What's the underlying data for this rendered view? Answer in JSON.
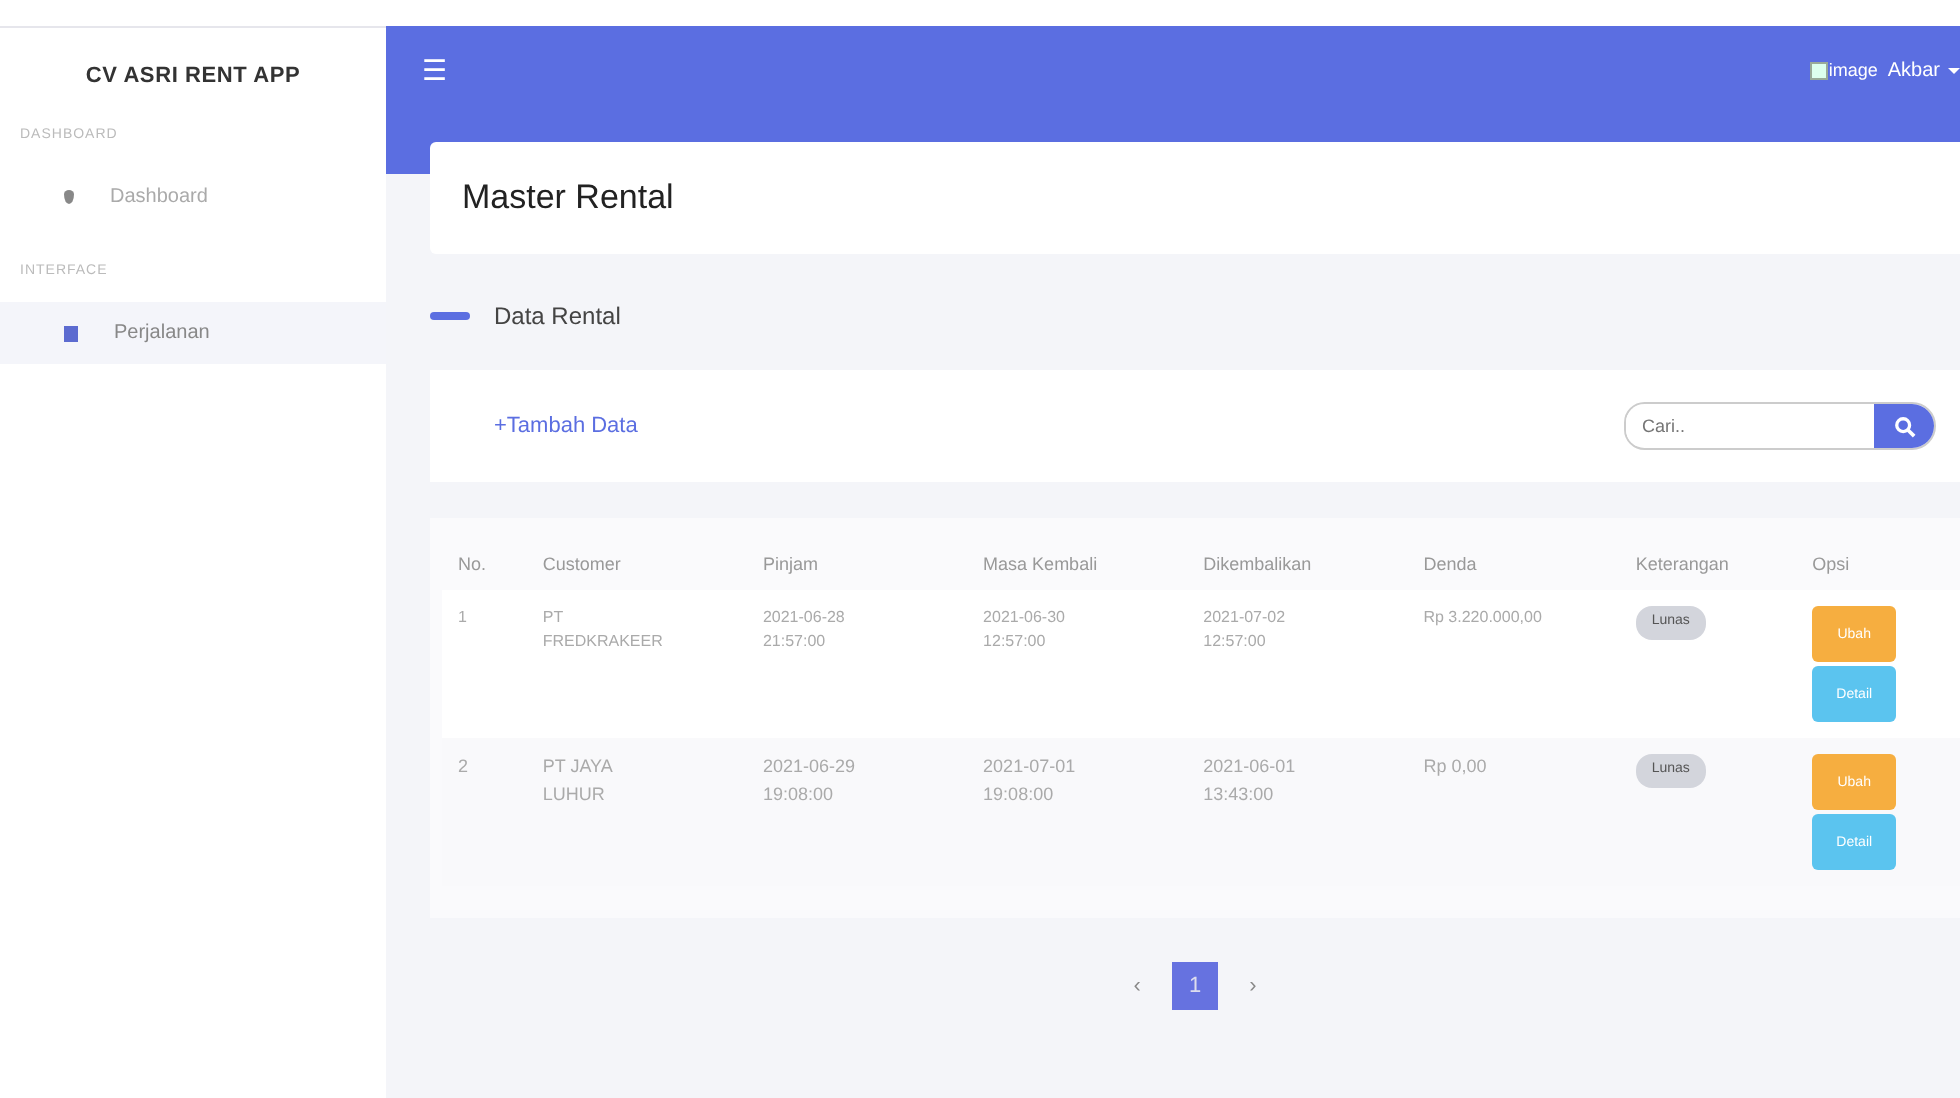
{
  "sidebar": {
    "brand": "CV ASRI RENT APP",
    "sections": [
      {
        "heading": "DASHBOARD",
        "items": [
          {
            "label": "Dashboard",
            "selected": false
          }
        ]
      },
      {
        "heading": "INTERFACE",
        "items": [
          {
            "label": "Perjalanan",
            "selected": true
          }
        ]
      }
    ]
  },
  "topbar": {
    "menu": "☰",
    "image_alt": "image",
    "user": "Akbar"
  },
  "page_title": "Master Rental",
  "section_title": "Data Rental",
  "toolbar": {
    "add": "+Tambah Data",
    "search": {
      "placeholder": "Cari.."
    }
  },
  "table": {
    "columns": [
      "No.",
      "Customer",
      "Pinjam",
      "Masa Kembali",
      "Dikembalikan",
      "Denda",
      "Keterangan",
      "Opsi"
    ],
    "rows": [
      {
        "cells": [
          "1",
          "PT FREDKRAKEER",
          "2021-06-28 21:57:00",
          "2021-06-30 12:57:00",
          "2021-07-02 12:57:00",
          "Rp 3.220.000,00"
        ],
        "status": "Lunas",
        "actions": [
          {
            "label": "Ubah",
            "kind": "edit"
          },
          {
            "label": "Detail",
            "kind": "detail"
          }
        ]
      },
      {
        "cells": [
          "2",
          "PT JAYA LUHUR",
          "2021-06-29 19:08:00",
          "2021-07-01 19:08:00",
          "2021-06-01 13:43:00",
          "Rp 0,00"
        ],
        "status": "Lunas",
        "actions": [
          {
            "label": "Ubah",
            "kind": "edit"
          },
          {
            "label": "Detail",
            "kind": "detail"
          }
        ]
      }
    ]
  },
  "pagination": [
    {
      "label": "‹",
      "selected": false
    },
    {
      "label": "1",
      "selected": true
    },
    {
      "label": "›",
      "selected": false
    }
  ]
}
